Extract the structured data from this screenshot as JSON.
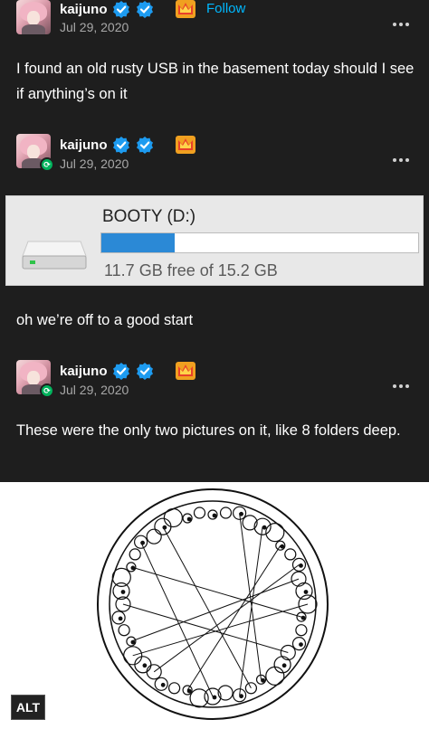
{
  "posts": [
    {
      "username": "kaijuno",
      "date": "Jul 29, 2020",
      "follow_label": "Follow",
      "text": "I found an old rusty USB in the basement today should I see if anything’s on it"
    },
    {
      "username": "kaijuno",
      "date": "Jul 29, 2020",
      "text": "oh we’re off to a good start"
    },
    {
      "username": "kaijuno",
      "date": "Jul 29, 2020",
      "text": "These were the only two pictures on it, like 8 folders deep."
    }
  ],
  "drive": {
    "name": "BOOTY (D:)",
    "free_text": "11.7 GB free of 15.2 GB",
    "used_fraction": 0.23
  },
  "image": {
    "alt_label": "ALT"
  },
  "colors": {
    "background": "#1e1e1e",
    "link": "#00b8ff",
    "verified": "#1d9bf0",
    "reblog": "#00b25c",
    "drive_bar": "#2b89d6"
  },
  "icons": [
    "verified-badge-icon",
    "crown-badge-icon",
    "reblog-icon",
    "more-options-icon",
    "drive-icon"
  ]
}
